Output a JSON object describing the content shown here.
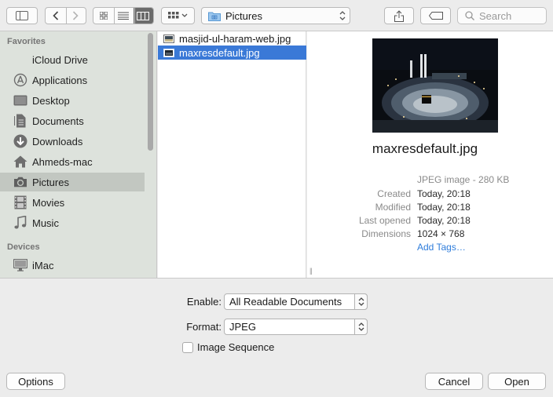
{
  "toolbar": {
    "location": "Pictures",
    "search_placeholder": "Search",
    "icons": [
      "sidebar-toggle-icon",
      "back-icon",
      "forward-icon",
      "icon-view-icon",
      "list-view-icon",
      "column-view-icon",
      "arrange-icon",
      "share-icon",
      "tag-icon",
      "search-icon"
    ]
  },
  "sidebar": {
    "favorites_header": "Favorites",
    "devices_header": "Devices",
    "items": [
      {
        "label": "iCloud Drive",
        "icon": "cloud-icon"
      },
      {
        "label": "Applications",
        "icon": "applications-icon"
      },
      {
        "label": "Desktop",
        "icon": "desktop-icon"
      },
      {
        "label": "Documents",
        "icon": "documents-icon"
      },
      {
        "label": "Downloads",
        "icon": "downloads-icon"
      },
      {
        "label": "Ahmeds-mac",
        "icon": "home-icon"
      },
      {
        "label": "Pictures",
        "icon": "camera-icon",
        "selected": true
      },
      {
        "label": "Movies",
        "icon": "film-icon"
      },
      {
        "label": "Music",
        "icon": "music-note-icon"
      }
    ],
    "devices": [
      {
        "label": "iMac",
        "icon": "imac-icon"
      }
    ]
  },
  "files": [
    {
      "name": "masjid-ul-haram-web.jpg",
      "selected": false
    },
    {
      "name": "maxresdefault.jpg",
      "selected": true
    }
  ],
  "preview": {
    "name": "maxresdefault.jpg",
    "kind": "JPEG image - 280 KB",
    "created_label": "Created",
    "created": "Today, 20:18",
    "modified_label": "Modified",
    "modified": "Today, 20:18",
    "opened_label": "Last opened",
    "opened": "Today, 20:18",
    "dimensions_label": "Dimensions",
    "dimensions": "1024 × 768",
    "add_tags": "Add Tags…"
  },
  "bottom": {
    "enable_label": "Enable:",
    "enable_value": "All Readable Documents",
    "format_label": "Format:",
    "format_value": "JPEG",
    "image_sequence": "Image Sequence",
    "image_sequence_checked": false,
    "options": "Options",
    "cancel": "Cancel",
    "open": "Open"
  },
  "colors": {
    "selection": "#3a79d7",
    "sidebar_bg": "#dde2dc",
    "link": "#2f7ddb"
  }
}
